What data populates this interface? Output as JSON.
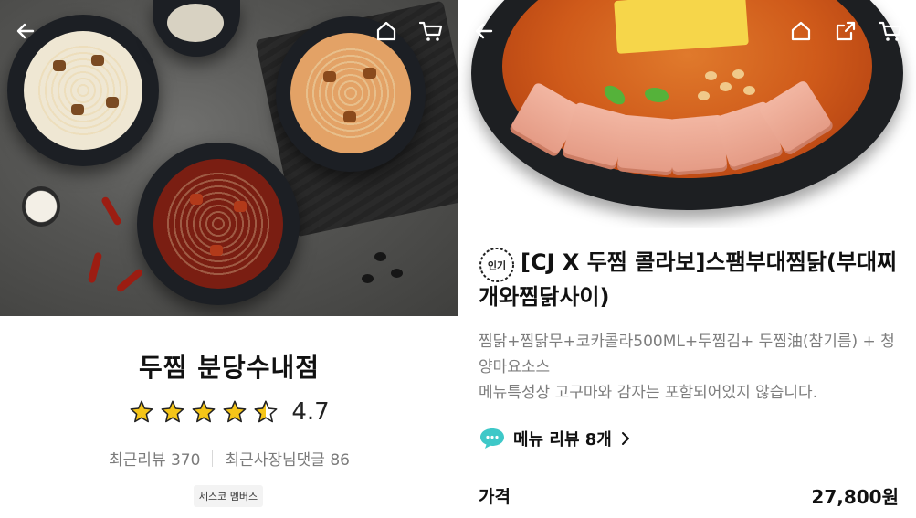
{
  "left_panel": {
    "store_name": "두찜 분당수내점",
    "rating": 4.7,
    "rating_text": "4.7",
    "stars_filled": 4.5,
    "recent_reviews_label": "최근리뷰 370",
    "owner_replies_label": "최근사장님댓글 86",
    "membership_badge": "세스코 멤버스",
    "icons": [
      "back-arrow-icon",
      "home-icon",
      "cart-icon"
    ]
  },
  "right_panel": {
    "popular_badge": "인기",
    "menu_title": "[CJ X 두찜 콜라보]스팸부대찜닭(부대찌개와찜닭사이)",
    "menu_description": "찜닭+찜닭무+코카콜라500ML+두찜김+ 두찜油(참기름) + 청양마요소스",
    "menu_note": "메뉴특성상 고구마와 감자는 포함되어있지 않습니다.",
    "review_link_label": "메뉴 리뷰 8개",
    "price_label": "가격",
    "price_value": "27,800원",
    "icons": [
      "back-arrow-icon",
      "home-icon",
      "share-icon",
      "cart-icon"
    ]
  },
  "colors": {
    "star_yellow": "#f5c518",
    "review_bubble": "#3ec8c8",
    "text_primary": "#111111",
    "text_secondary": "#7d7d7d"
  }
}
